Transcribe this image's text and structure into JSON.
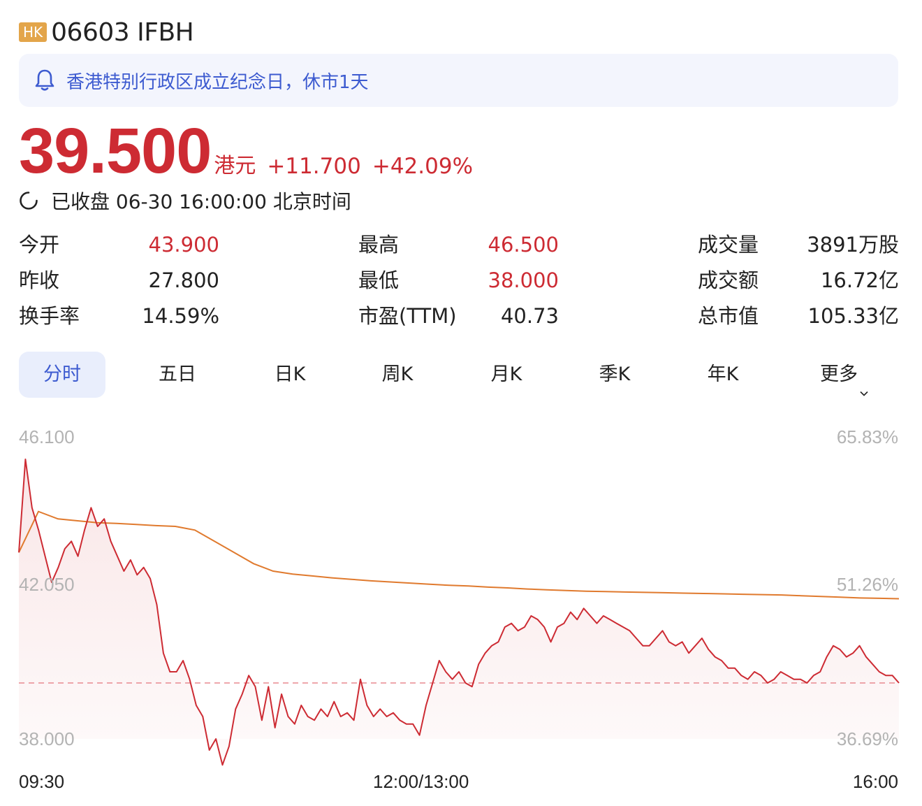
{
  "header": {
    "market_badge": "HK",
    "title": "06603 IFBH"
  },
  "notice": {
    "icon": "bell-icon",
    "text": "香港特别行政区成立纪念日，休市1天"
  },
  "quote": {
    "price": "39.500",
    "currency": "港元",
    "change": "+11.700",
    "change_pct": "+42.09%",
    "status": "已收盘 06-30 16:00:00 北京时间"
  },
  "colors": {
    "up": "#cd2b33",
    "avg_line": "#e07a2e",
    "accent": "#3d5bd0",
    "notice_bg": "#f3f5fd"
  },
  "stats": [
    [
      {
        "label": "今开",
        "value": "43.900",
        "tone": "red"
      },
      {
        "label": "最高",
        "value": "46.500",
        "tone": "red"
      },
      {
        "label": "成交量",
        "value": "3891万股",
        "tone": "dark"
      }
    ],
    [
      {
        "label": "昨收",
        "value": "27.800",
        "tone": "dark"
      },
      {
        "label": "最低",
        "value": "38.000",
        "tone": "red"
      },
      {
        "label": "成交额",
        "value": "16.72亿",
        "tone": "dark"
      }
    ],
    [
      {
        "label": "换手率",
        "value": "14.59%",
        "tone": "dark"
      },
      {
        "label": "市盈(TTM)",
        "value": "40.73",
        "tone": "dark"
      },
      {
        "label": "总市值",
        "value": "105.33亿",
        "tone": "dark"
      }
    ]
  ],
  "tabs": [
    "分时",
    "五日",
    "日K",
    "周K",
    "月K",
    "季K",
    "年K",
    "更多"
  ],
  "active_tab": "分时",
  "chart_data": {
    "type": "line",
    "y_labels_left": [
      "46.100",
      "42.050",
      "38.000"
    ],
    "y_labels_right": [
      "65.83%",
      "51.26%",
      "36.69%"
    ],
    "x_labels": [
      "09:30",
      "12:00/13:00",
      "16:00"
    ],
    "ylim": [
      38.0,
      46.1
    ],
    "reference_price": 39.5,
    "series": [
      {
        "values": [
          43.0,
          45.5,
          44.2,
          43.6,
          42.9,
          42.2,
          42.6,
          43.1,
          43.3,
          42.9,
          43.6,
          44.2,
          43.7,
          43.9,
          43.3,
          42.9,
          42.5,
          42.8,
          42.4,
          42.6,
          42.3,
          41.6,
          40.3,
          39.8,
          39.8,
          40.1,
          39.6,
          38.9,
          38.6,
          37.7,
          38.0,
          37.3,
          37.8,
          38.8,
          39.2,
          39.7,
          39.4,
          38.5,
          39.4,
          38.3,
          39.2,
          38.6,
          38.4,
          38.9,
          38.6,
          38.5,
          38.8,
          38.6,
          39.0,
          38.6,
          38.7,
          38.5,
          39.6,
          38.9,
          38.6,
          38.8,
          38.6,
          38.7,
          38.5,
          38.4,
          38.4,
          38.1,
          38.9,
          39.5,
          40.1,
          39.8,
          39.6,
          39.8,
          39.5,
          39.4,
          40.0,
          40.3,
          40.5,
          40.6,
          41.0,
          41.1,
          40.9,
          41.0,
          41.3,
          41.2,
          41.0,
          40.6,
          41.0,
          41.1,
          41.4,
          41.2,
          41.5,
          41.3,
          41.1,
          41.3,
          41.2,
          41.1,
          41.0,
          40.9,
          40.7,
          40.5,
          40.5,
          40.7,
          40.9,
          40.6,
          40.5,
          40.6,
          40.3,
          40.5,
          40.7,
          40.4,
          40.2,
          40.1,
          39.9,
          39.9,
          39.7,
          39.6,
          39.8,
          39.7,
          39.5,
          39.6,
          39.8,
          39.7,
          39.6,
          39.6,
          39.5,
          39.7,
          39.8,
          40.2,
          40.5,
          40.4,
          40.2,
          40.3,
          40.5,
          40.2,
          40.0,
          39.8,
          39.7,
          39.7,
          39.5
        ],
        "note": "price"
      },
      {
        "values": [
          43.0,
          44.1,
          43.9,
          43.85,
          43.8,
          43.78,
          43.75,
          43.72,
          43.7,
          43.6,
          43.3,
          43.0,
          42.7,
          42.5,
          42.42,
          42.37,
          42.32,
          42.28,
          42.24,
          42.21,
          42.18,
          42.15,
          42.12,
          42.1,
          42.07,
          42.05,
          42.02,
          42.0,
          41.98,
          41.96,
          41.95,
          41.94,
          41.93,
          41.92,
          41.91,
          41.9,
          41.89,
          41.88,
          41.87,
          41.86,
          41.84,
          41.82,
          41.8,
          41.78,
          41.77,
          41.76
        ],
        "note": "average"
      }
    ]
  }
}
